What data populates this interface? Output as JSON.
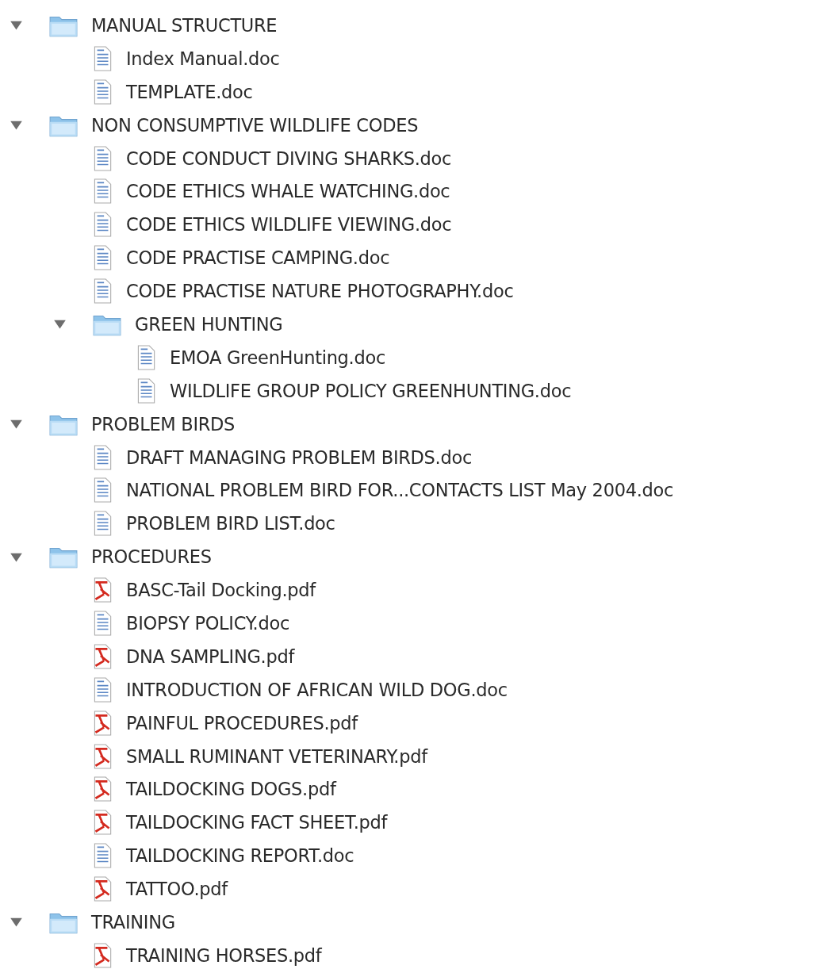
{
  "tree": [
    {
      "kind": "folder",
      "name": "MANUAL STRUCTURE",
      "expanded": true,
      "children": [
        {
          "kind": "doc",
          "name": "Index Manual.doc"
        },
        {
          "kind": "doc",
          "name": "TEMPLATE.doc"
        }
      ]
    },
    {
      "kind": "folder",
      "name": "NON CONSUMPTIVE WILDLIFE CODES",
      "expanded": true,
      "children": [
        {
          "kind": "doc",
          "name": "CODE CONDUCT DIVING SHARKS.doc"
        },
        {
          "kind": "doc",
          "name": "CODE ETHICS WHALE WATCHING.doc"
        },
        {
          "kind": "doc",
          "name": "CODE ETHICS WILDLIFE VIEWING.doc"
        },
        {
          "kind": "doc",
          "name": "CODE PRACTISE CAMPING.doc"
        },
        {
          "kind": "doc",
          "name": "CODE PRACTISE NATURE PHOTOGRAPHY.doc"
        },
        {
          "kind": "folder",
          "name": "GREEN HUNTING",
          "expanded": true,
          "children": [
            {
              "kind": "doc",
              "name": "EMOA GreenHunting.doc"
            },
            {
              "kind": "doc",
              "name": "WILDLIFE GROUP POLICY GREENHUNTING.doc"
            }
          ]
        }
      ]
    },
    {
      "kind": "folder",
      "name": "PROBLEM BIRDS",
      "expanded": true,
      "children": [
        {
          "kind": "doc",
          "name": "DRAFT MANAGING PROBLEM BIRDS.doc"
        },
        {
          "kind": "doc",
          "name": "NATIONAL PROBLEM BIRD FOR...CONTACTS LIST May 2004.doc"
        },
        {
          "kind": "doc",
          "name": "PROBLEM BIRD LIST.doc"
        }
      ]
    },
    {
      "kind": "folder",
      "name": "PROCEDURES",
      "expanded": true,
      "children": [
        {
          "kind": "pdf",
          "name": "BASC-Tail Docking.pdf"
        },
        {
          "kind": "doc",
          "name": "BIOPSY POLICY.doc"
        },
        {
          "kind": "pdf",
          "name": "DNA SAMPLING.pdf"
        },
        {
          "kind": "doc",
          "name": "INTRODUCTION OF AFRICAN WILD DOG.doc"
        },
        {
          "kind": "pdf",
          "name": "PAINFUL PROCEDURES.pdf"
        },
        {
          "kind": "pdf",
          "name": "SMALL RUMINANT VETERINARY.pdf"
        },
        {
          "kind": "pdf",
          "name": "TAILDOCKING DOGS.pdf"
        },
        {
          "kind": "pdf",
          "name": "TAILDOCKING FACT SHEET.pdf"
        },
        {
          "kind": "doc",
          "name": "TAILDOCKING REPORT.doc"
        },
        {
          "kind": "pdf",
          "name": "TATTOO.pdf"
        }
      ]
    },
    {
      "kind": "folder",
      "name": "TRAINING",
      "expanded": true,
      "children": [
        {
          "kind": "pdf",
          "name": "TRAINING HORSES.pdf"
        }
      ]
    }
  ]
}
